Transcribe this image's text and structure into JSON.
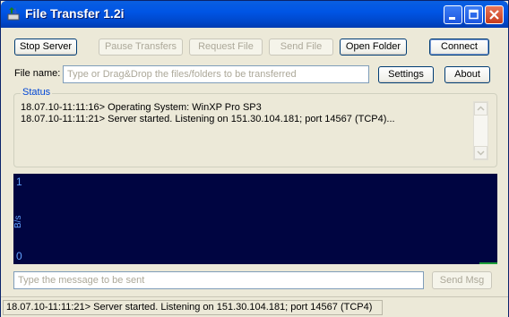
{
  "window": {
    "title": "File Transfer 1.2i"
  },
  "toolbar": {
    "stop_server": "Stop Server",
    "pause_transfers": "Pause Transfers",
    "request_file": "Request File",
    "send_file": "Send File",
    "open_folder": "Open Folder",
    "connect": "Connect"
  },
  "file_row": {
    "label": "File name:",
    "placeholder": "Type or Drag&Drop the files/folders to be transferred",
    "settings": "Settings",
    "about": "About"
  },
  "status": {
    "title": "Status",
    "log": [
      "18.07.10-11:11:16> Operating System: WinXP Pro SP3",
      "18.07.10-11:11:21> Server started. Listening on 151.30.104.181;  port 14567 (TCP4)..."
    ]
  },
  "graph": {
    "y_max_label": "1",
    "y_min_label": "0",
    "unit_label": "B/s",
    "colors": {
      "background": "#000541",
      "text": "#62a3ff"
    }
  },
  "message": {
    "placeholder": "Type the message to be sent",
    "send": "Send Msg"
  },
  "statusbar": {
    "text": "18.07.10-11:11:21> Server started. Listening on 151.30.104.181;  port 14567 (TCP4)"
  }
}
